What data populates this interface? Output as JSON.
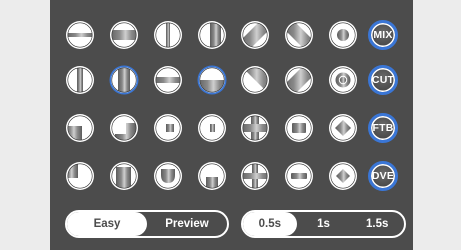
{
  "grid": {
    "rows": [
      [
        "wipe-horizontal-icon",
        "wipe-horizontal-band-icon",
        "wipe-vertical-split-icon",
        "wipe-vertical-band-icon",
        "wipe-diagonal-bl-tr-icon",
        "wipe-diagonal-tl-br-icon",
        "wipe-circle-icon"
      ],
      [
        "wipe-vertical-center-icon",
        "wipe-vertical-band-selected-icon",
        "wipe-horizontal-center-icon",
        "wipe-horizontal-split-selected-icon",
        "wipe-diagonal-corner-tl-icon",
        "wipe-diagonal-corner-br-icon",
        "wipe-ring-icon"
      ],
      [
        "wipe-corner-tl-icon",
        "wipe-corner-tr-icon",
        "wipe-square-center-icon",
        "wipe-half-square-icon",
        "wipe-cross-icon",
        "wipe-rect-center-icon",
        "wipe-diamond-center-icon"
      ],
      [
        "wipe-corner-bl-icon",
        "wipe-corner-br-icon",
        "wipe-rounded-bottom-icon",
        "wipe-bottom-notch-icon",
        "wipe-plus-icon",
        "wipe-bar-icon",
        "wipe-diamond-icon"
      ]
    ],
    "selected": [
      "1-1",
      "1-3"
    ]
  },
  "modes": [
    "MIX",
    "CUT",
    "FTB",
    "DVE"
  ],
  "panel_mode": {
    "options": [
      "Easy",
      "Preview"
    ],
    "active": "Easy"
  },
  "duration": {
    "options": [
      "0.5s",
      "1s",
      "1.5s"
    ],
    "active": "0.5s"
  },
  "colors": {
    "panel_bg": "#4c4c4c",
    "accent": "#3a76d6",
    "button_face": "#ffffff"
  }
}
